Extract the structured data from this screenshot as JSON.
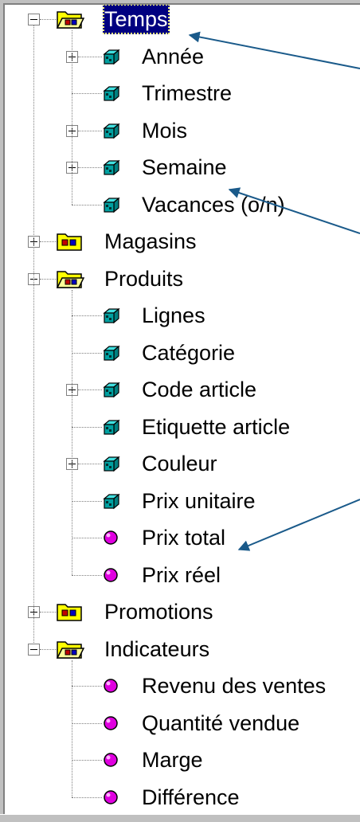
{
  "colors": {
    "selection_bg": "#000080",
    "arrow": "#1a5a8a",
    "measure": "#e000e0",
    "level_cube": "#00a0a0",
    "folder": "#ffff00"
  },
  "tree": [
    {
      "label": "Temps",
      "type": "dimension",
      "expanded": true,
      "selected": true,
      "icon": "open-folder-icon",
      "children": [
        {
          "label": "Année",
          "type": "level",
          "expandable": true,
          "icon": "cube-icon"
        },
        {
          "label": "Trimestre",
          "type": "level",
          "expandable": false,
          "icon": "cube-icon"
        },
        {
          "label": "Mois",
          "type": "level",
          "expandable": true,
          "icon": "cube-icon"
        },
        {
          "label": "Semaine",
          "type": "level",
          "expandable": true,
          "icon": "cube-icon"
        },
        {
          "label": "Vacances (o/n)",
          "type": "level",
          "expandable": false,
          "icon": "cube-icon"
        }
      ]
    },
    {
      "label": "Magasins",
      "type": "dimension",
      "expanded": false,
      "icon": "closed-folder-icon"
    },
    {
      "label": "Produits",
      "type": "dimension",
      "expanded": true,
      "icon": "open-folder-icon",
      "children": [
        {
          "label": "Lignes",
          "type": "level",
          "expandable": false,
          "icon": "cube-icon"
        },
        {
          "label": "Catégorie",
          "type": "level",
          "expandable": false,
          "icon": "cube-icon"
        },
        {
          "label": "Code article",
          "type": "level",
          "expandable": true,
          "icon": "cube-icon"
        },
        {
          "label": "Etiquette article",
          "type": "level",
          "expandable": false,
          "icon": "cube-icon"
        },
        {
          "label": "Couleur",
          "type": "level",
          "expandable": true,
          "icon": "cube-icon"
        },
        {
          "label": "Prix unitaire",
          "type": "level",
          "expandable": false,
          "icon": "cube-icon"
        },
        {
          "label": "Prix total",
          "type": "measure",
          "expandable": false,
          "icon": "measure-dot-icon"
        },
        {
          "label": "Prix réel",
          "type": "measure",
          "expandable": false,
          "icon": "measure-dot-icon"
        }
      ]
    },
    {
      "label": "Promotions",
      "type": "dimension",
      "expanded": false,
      "icon": "closed-folder-icon"
    },
    {
      "label": "Indicateurs",
      "type": "dimension",
      "expanded": true,
      "icon": "open-folder-icon",
      "children": [
        {
          "label": "Revenu des ventes",
          "type": "measure",
          "expandable": false,
          "icon": "measure-dot-icon"
        },
        {
          "label": "Quantité vendue",
          "type": "measure",
          "expandable": false,
          "icon": "measure-dot-icon"
        },
        {
          "label": "Marge",
          "type": "measure",
          "expandable": false,
          "icon": "measure-dot-icon"
        },
        {
          "label": "Différence",
          "type": "measure",
          "expandable": false,
          "icon": "measure-dot-icon"
        }
      ]
    }
  ]
}
